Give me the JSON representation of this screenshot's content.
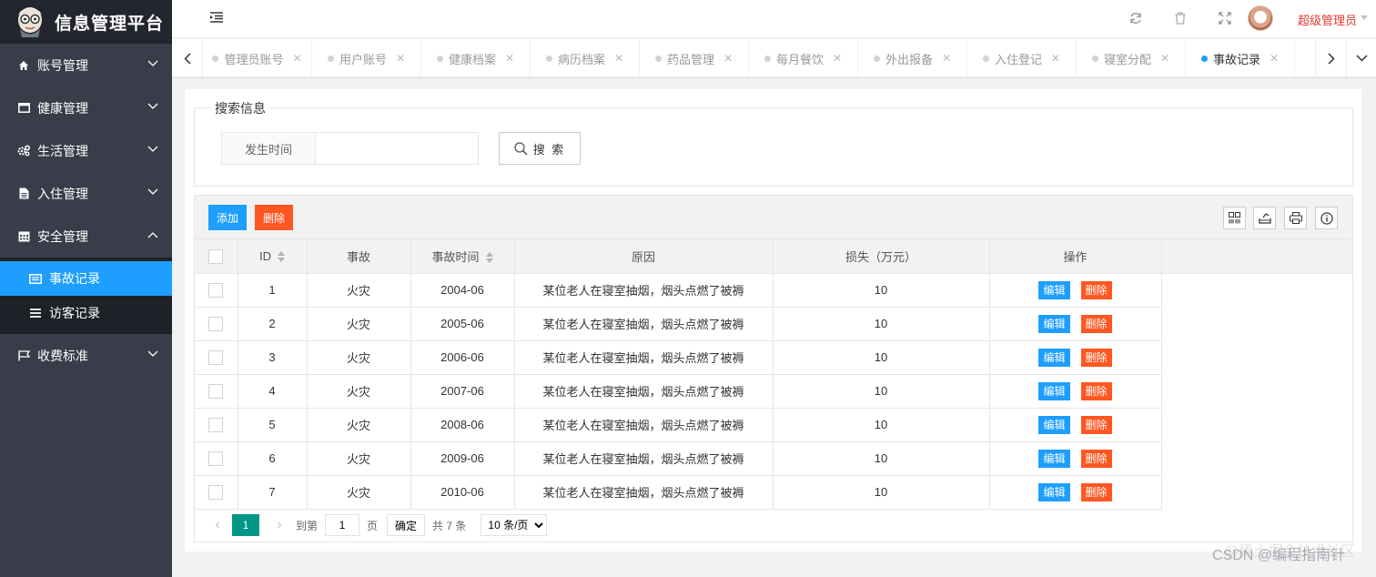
{
  "app": {
    "title": "信息管理平台"
  },
  "sidebar": {
    "items": [
      {
        "label": "账号管理",
        "icon": "home-icon"
      },
      {
        "label": "健康管理",
        "icon": "window-icon"
      },
      {
        "label": "生活管理",
        "icon": "gears-icon"
      },
      {
        "label": "入住管理",
        "icon": "file-icon"
      },
      {
        "label": "安全管理",
        "icon": "calendar-icon"
      },
      {
        "label": "收费标准",
        "icon": "flag-icon"
      }
    ],
    "sub_items": [
      {
        "label": "事故记录",
        "icon": "card-icon",
        "active": true
      },
      {
        "label": "访客记录",
        "icon": "list-icon",
        "active": false
      }
    ]
  },
  "header": {
    "user_name": "超级管理员"
  },
  "tabs": [
    {
      "label": "管理员账号",
      "active": false
    },
    {
      "label": "用户账号",
      "active": false
    },
    {
      "label": "健康档案",
      "active": false
    },
    {
      "label": "病历档案",
      "active": false
    },
    {
      "label": "药品管理",
      "active": false
    },
    {
      "label": "每月餐饮",
      "active": false
    },
    {
      "label": "外出报备",
      "active": false
    },
    {
      "label": "入住登记",
      "active": false
    },
    {
      "label": "寝室分配",
      "active": false
    },
    {
      "label": "事故记录",
      "active": true
    }
  ],
  "search": {
    "legend": "搜索信息",
    "field_label": "发生时间",
    "field_value": "",
    "button_label": "搜 索"
  },
  "toolbar": {
    "add_label": "添加",
    "delete_label": "删除"
  },
  "table": {
    "headers": {
      "id": "ID",
      "accident": "事故",
      "time": "事故时间",
      "reason": "原因",
      "loss": "损失（万元）",
      "ops": "操作"
    },
    "edit_label": "编辑",
    "delete_label": "删除",
    "rows": [
      {
        "id": "1",
        "accident": "火灾",
        "time": "2004-06",
        "reason": "某位老人在寝室抽烟，烟头点燃了被褥",
        "loss": "10"
      },
      {
        "id": "2",
        "accident": "火灾",
        "time": "2005-06",
        "reason": "某位老人在寝室抽烟，烟头点燃了被褥",
        "loss": "10"
      },
      {
        "id": "3",
        "accident": "火灾",
        "time": "2006-06",
        "reason": "某位老人在寝室抽烟，烟头点燃了被褥",
        "loss": "10"
      },
      {
        "id": "4",
        "accident": "火灾",
        "time": "2007-06",
        "reason": "某位老人在寝室抽烟，烟头点燃了被褥",
        "loss": "10"
      },
      {
        "id": "5",
        "accident": "火灾",
        "time": "2008-06",
        "reason": "某位老人在寝室抽烟，烟头点燃了被褥",
        "loss": "10"
      },
      {
        "id": "6",
        "accident": "火灾",
        "time": "2009-06",
        "reason": "某位老人在寝室抽烟，烟头点燃了被褥",
        "loss": "10"
      },
      {
        "id": "7",
        "accident": "火灾",
        "time": "2010-06",
        "reason": "某位老人在寝室抽烟，烟头点燃了被褥",
        "loss": "10"
      }
    ]
  },
  "pager": {
    "current": "1",
    "goto_label": "到第",
    "goto_value": "1",
    "page_unit": "页",
    "confirm_label": "确定",
    "total_label": "共 7 条",
    "page_size_label": "10 条/页"
  },
  "watermark": {
    "line1": "@稀土掘金技术社区",
    "line2": "CSDN @编程指南针"
  },
  "colors": {
    "accent": "#1e9fff",
    "danger": "#ff5722",
    "sidebar": "#393d49",
    "pager": "#009688"
  }
}
